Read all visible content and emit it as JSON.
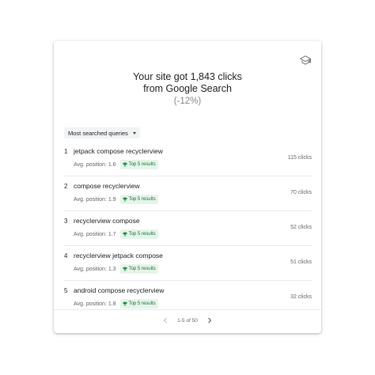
{
  "headline": {
    "line1": "Your site got 1,843 clicks",
    "line2": "from Google Search",
    "change": "(-12%)"
  },
  "icons": {
    "learn": "graduation-cap-icon",
    "badge": "trophy-icon"
  },
  "dropdown": {
    "label": "Most searched queries"
  },
  "queries": [
    {
      "rank": "1",
      "query": "jetpack compose recyclerview",
      "position": "Avg. position: 1.6",
      "badge": "Top 5 results",
      "clicks": "115 clicks"
    },
    {
      "rank": "2",
      "query": "compose recyclerview",
      "position": "Avg. position: 1.9",
      "badge": "Top 5 results",
      "clicks": "70 clicks"
    },
    {
      "rank": "3",
      "query": "recyclerview compose",
      "position": "Avg. position: 1.7",
      "badge": "Top 5 results",
      "clicks": "52 clicks"
    },
    {
      "rank": "4",
      "query": "recyclerview jetpack compose",
      "position": "Avg. position: 1.3",
      "badge": "Top 5 results",
      "clicks": "51 clicks"
    },
    {
      "rank": "5",
      "query": "android compose recyclerview",
      "position": "Avg. position: 1.8",
      "badge": "Top 5 results",
      "clicks": "32 clicks"
    }
  ],
  "pagination": {
    "label": "1-5 of 50"
  },
  "colors": {
    "badge_bg": "#e6f4ea",
    "badge_text": "#137333",
    "muted": "#5f6368"
  }
}
